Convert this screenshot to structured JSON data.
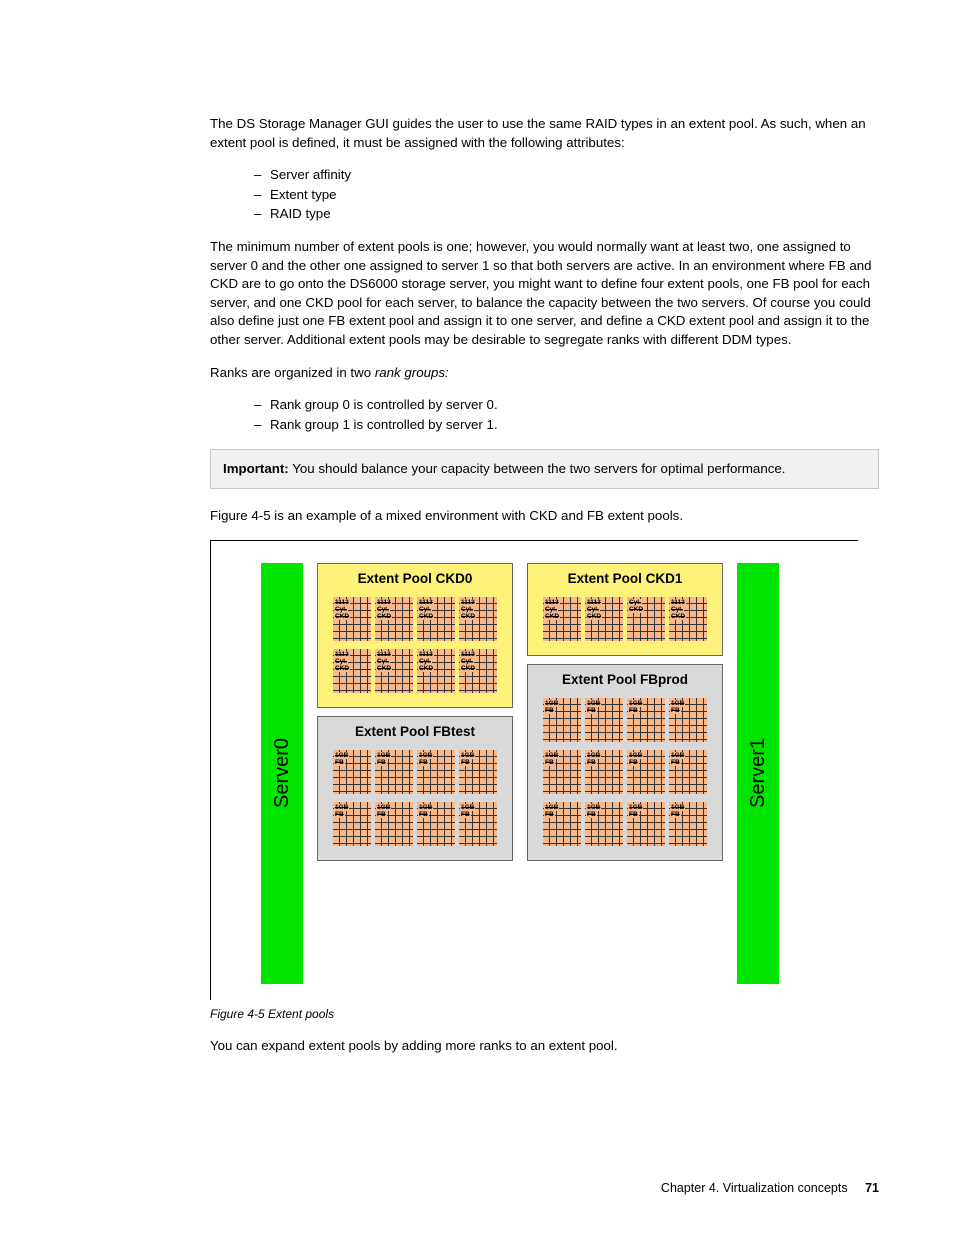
{
  "para1": "The DS Storage Manager GUI guides the user to use the same RAID types in an extent pool. As such, when an extent pool is defined, it must be assigned with the following attributes:",
  "list1": [
    "Server affinity",
    "Extent type",
    "RAID type"
  ],
  "para2": "The minimum number of extent pools is one; however, you would normally want at least two, one assigned to server 0 and the other one assigned to server 1 so that both servers are active. In an environment where FB and CKD are to go onto the DS6000 storage server, you might want to define four extent pools, one FB pool for each server, and one CKD pool for each server, to balance the capacity between the two servers. Of course you could also define just one FB extent pool and assign it to one server, and define a CKD extent pool and assign it to the other server. Additional extent pools may be desirable to segregate ranks with different DDM types.",
  "para3_a": "Ranks are organized in two ",
  "para3_i": "rank groups:",
  "list2": [
    "Rank group 0 is controlled by server 0.",
    "Rank group 1 is controlled by server 1."
  ],
  "note_label": "Important:",
  "note_body": " You should balance your capacity between the two servers for optimal performance.",
  "para4": "Figure 4-5 is an example of a mixed environment with CKD and FB extent pools.",
  "fig": {
    "server0": "Server0",
    "server1": "Server1",
    "pools": {
      "ckd0": "Extent Pool CKD0",
      "ckd1": "Extent Pool CKD1",
      "fbtest": "Extent Pool FBtest",
      "fbprod": "Extent Pool FBprod"
    },
    "ext_ckd": [
      "1113",
      "Cyl.",
      "CKD"
    ],
    "ext_fb": [
      "1GB",
      "FB"
    ]
  },
  "fig_caption": "Figure 4-5   Extent pools",
  "para5": "You can expand extent pools by adding more ranks to an extent pool.",
  "footer_chapter": "Chapter 4. Virtualization concepts",
  "footer_page": "71"
}
